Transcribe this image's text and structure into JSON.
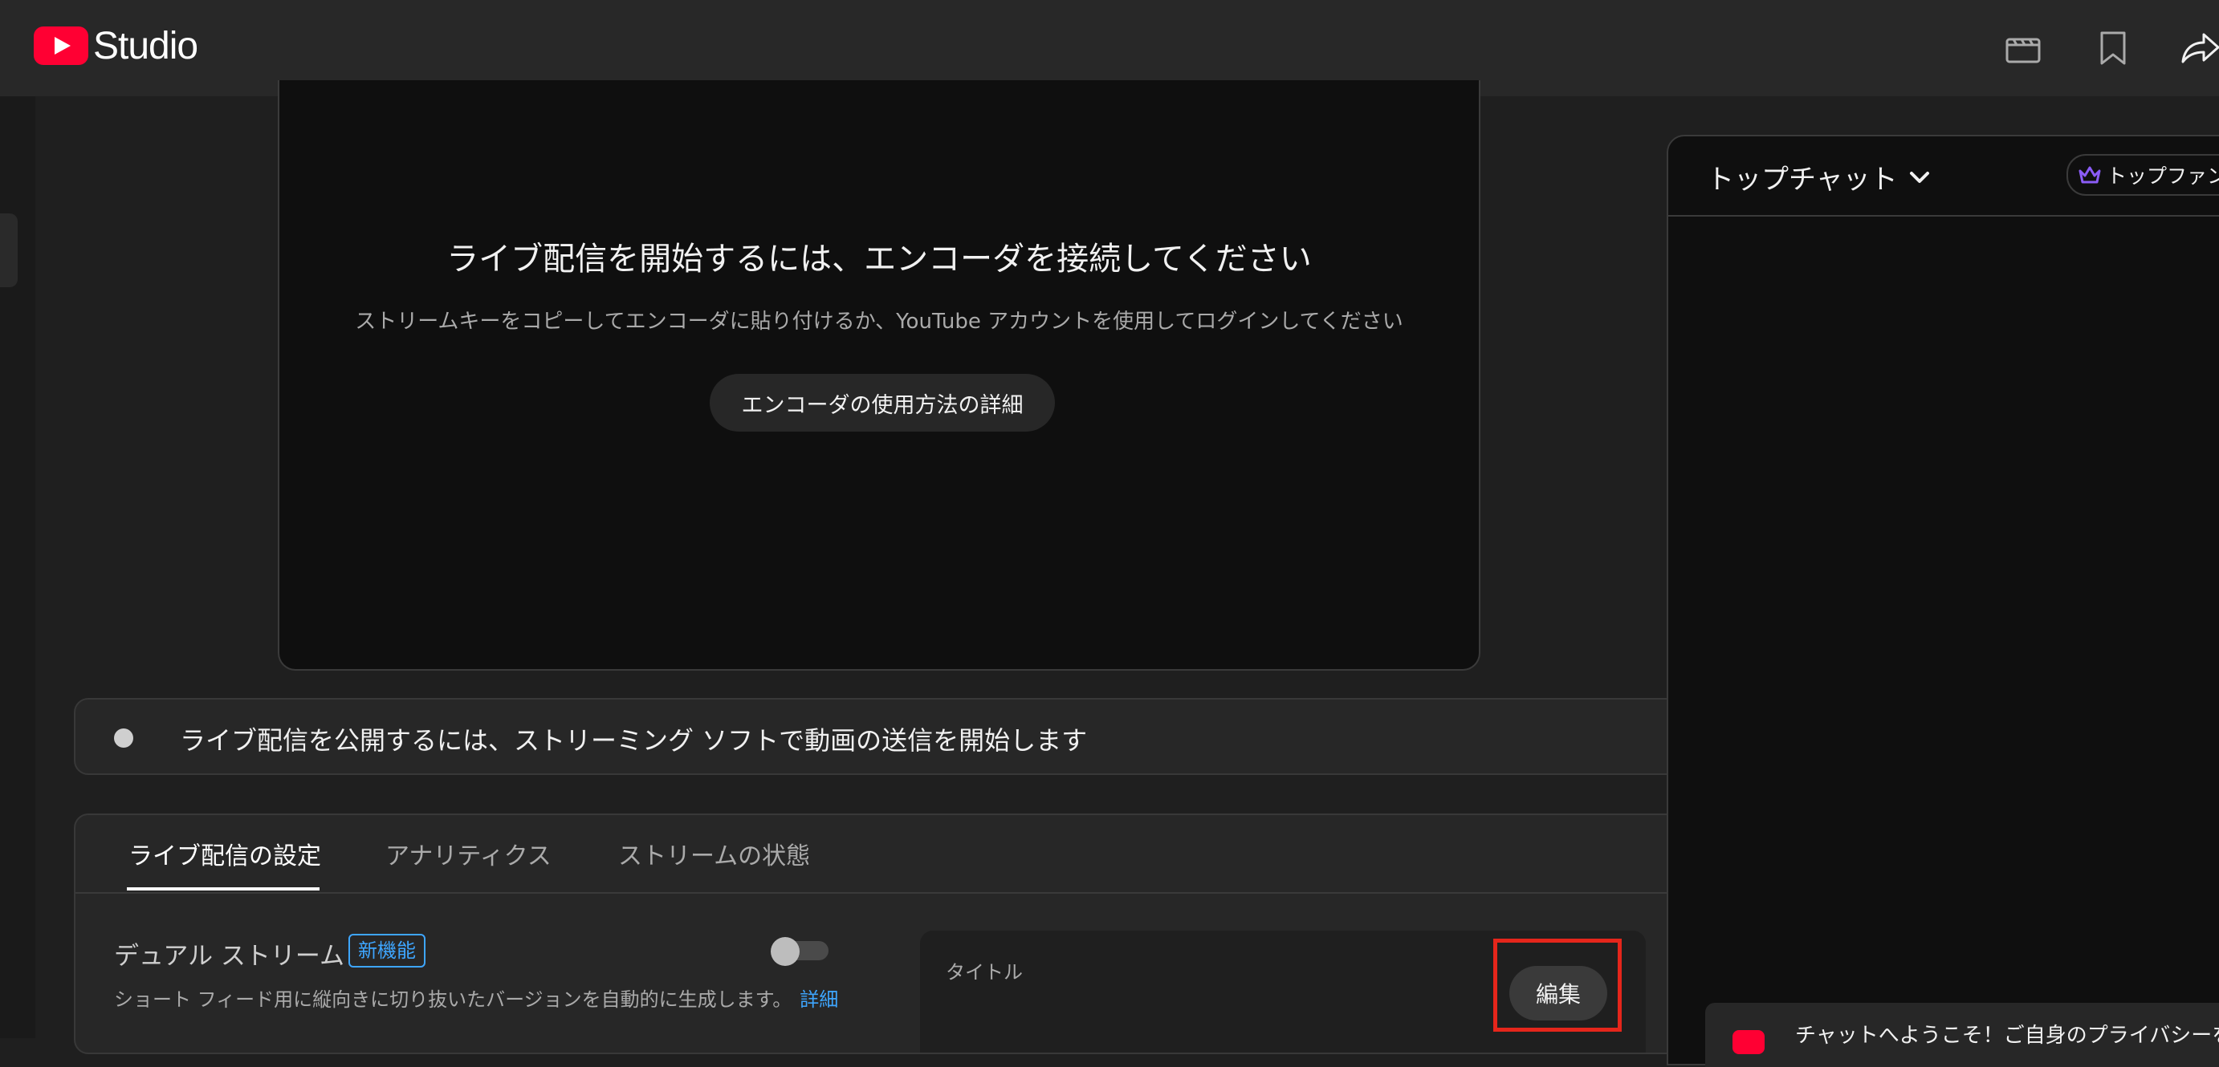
{
  "header": {
    "logo_text": "Studio",
    "icons": [
      "clapperboard-icon",
      "bookmark-icon",
      "share-icon"
    ]
  },
  "preview": {
    "title": "ライブ配信を開始するには、エンコーダを接続してください",
    "subtitle": "ストリームキーをコピーしてエンコーダに貼り付けるか、YouTube アカウントを使用してログインしてください",
    "learn_button": "エンコーダの使用方法の詳細"
  },
  "status": {
    "text": "ライブ配信を公開するには、ストリーミング ソフトで動画の送信を開始します"
  },
  "tabs": [
    {
      "label": "ライブ配信の設定",
      "active": true
    },
    {
      "label": "アナリティクス",
      "active": false
    },
    {
      "label": "ストリームの状態",
      "active": false
    }
  ],
  "dual_stream": {
    "label": "デュアル ストリーム",
    "badge": "新機能",
    "enabled": false,
    "description": "ショート フィード用に縦向きに切り抜いたバージョンを自動的に生成します。",
    "more_link": "詳細"
  },
  "title_card": {
    "label": "タイトル",
    "edit_button": "編集"
  },
  "chat": {
    "title": "トップチャット",
    "top_fan_label": "トップファン",
    "welcome_text": "チャットへようこそ！ご自身のプライバシーを守"
  },
  "colors": {
    "accent_link": "#3ea6ff",
    "highlight_box": "#e5261b",
    "brand_red": "#ff0033",
    "crown": "#8b5cf6"
  }
}
